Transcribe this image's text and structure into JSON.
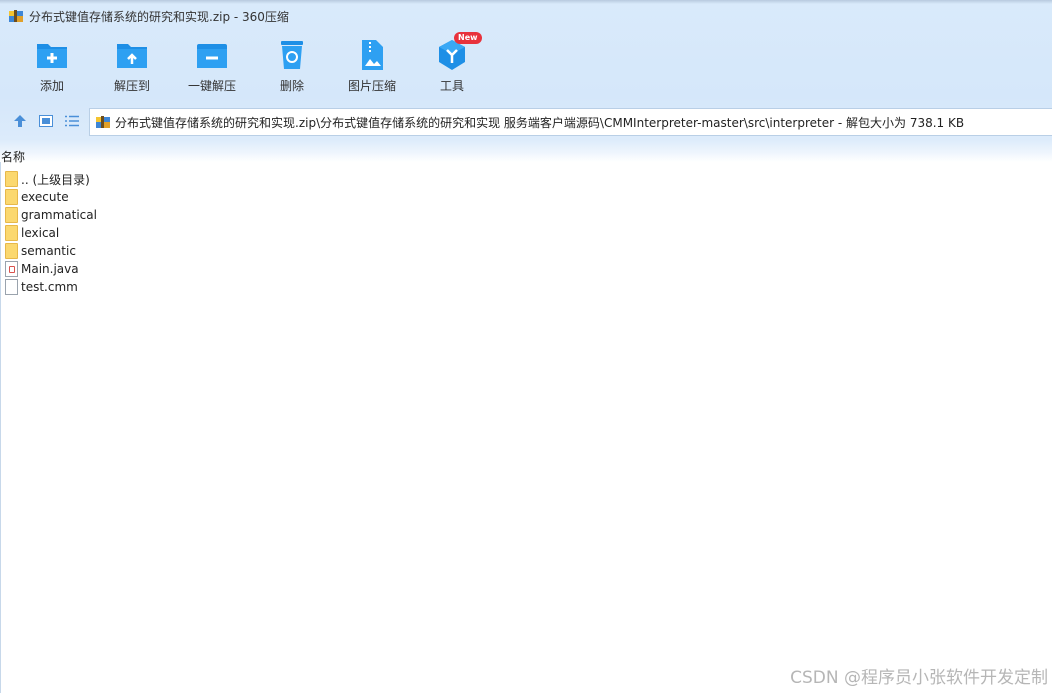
{
  "window": {
    "title": "分布式键值存储系统的研究和实现.zip - 360压缩"
  },
  "toolbar": {
    "items": [
      {
        "label": "添加",
        "icon": "add-folder-icon"
      },
      {
        "label": "解压到",
        "icon": "extract-to-icon"
      },
      {
        "label": "一键解压",
        "icon": "one-click-extract-icon"
      },
      {
        "label": "删除",
        "icon": "recycle-bin-icon"
      },
      {
        "label": "图片压缩",
        "icon": "image-compress-icon"
      },
      {
        "label": "工具",
        "icon": "tools-cube-icon",
        "badge": "New"
      }
    ]
  },
  "nav": {
    "path": "分布式键值存储系统的研究和实现.zip\\分布式键值存储系统的研究和实现 服务端客户端源码\\CMMInterpreter-master\\src\\interpreter - 解包大小为 738.1 KB"
  },
  "list": {
    "column_name": "名称",
    "items": [
      {
        "name": ".. (上级目录)",
        "type": "folder"
      },
      {
        "name": "execute",
        "type": "folder"
      },
      {
        "name": "grammatical",
        "type": "folder"
      },
      {
        "name": "lexical",
        "type": "folder"
      },
      {
        "name": "semantic",
        "type": "folder"
      },
      {
        "name": "Main.java",
        "type": "java"
      },
      {
        "name": "test.cmm",
        "type": "file"
      }
    ]
  },
  "watermark": "CSDN @程序员小张软件开发定制",
  "colors": {
    "accent": "#1e8fe6",
    "chrome_bg": "#d9eafb",
    "badge": "#e8323c"
  }
}
